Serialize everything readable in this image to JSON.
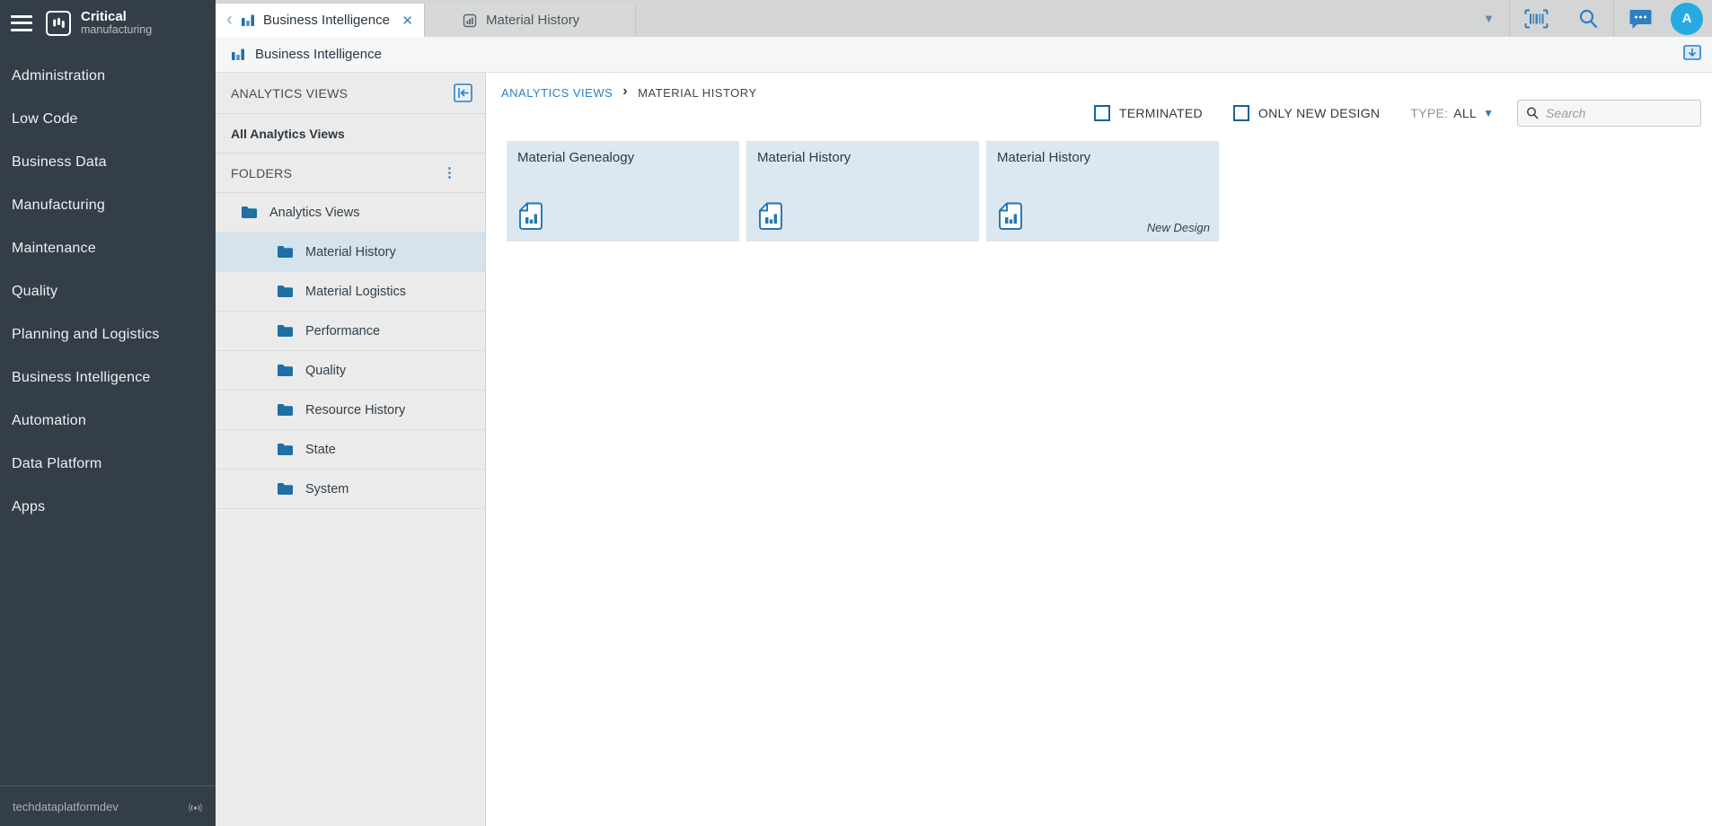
{
  "sidebar": {
    "logo": {
      "title": "Critical",
      "subtitle": "manufacturing"
    },
    "items": [
      "Administration",
      "Low Code",
      "Business Data",
      "Manufacturing",
      "Maintenance",
      "Quality",
      "Planning and Logistics",
      "Business Intelligence",
      "Automation",
      "Data Platform",
      "Apps"
    ],
    "footer": {
      "environment": "techdataplatformdev"
    }
  },
  "tabbar": {
    "tabs": [
      {
        "label": "Business Intelligence",
        "active": true
      },
      {
        "label": "Material History",
        "active": false
      }
    ]
  },
  "toolbar": {
    "avatar_initial": "A"
  },
  "breadcrumb_row": {
    "title": "Business Intelligence"
  },
  "panel": {
    "title": "ANALYTICS VIEWS",
    "all_views_label": "All Analytics Views",
    "folders_title": "FOLDERS",
    "tree": {
      "root": "Analytics Views",
      "children": [
        "Material History",
        "Material Logistics",
        "Performance",
        "Quality",
        "Resource History",
        "State",
        "System"
      ],
      "selected": "Material History"
    }
  },
  "main": {
    "breadcrumb": {
      "parent": "ANALYTICS VIEWS",
      "current": "MATERIAL HISTORY"
    },
    "filters": {
      "terminated_label": "TERMINATED",
      "only_new_design_label": "ONLY NEW DESIGN",
      "type_label": "TYPE:",
      "type_value": "ALL",
      "search_placeholder": "Search"
    },
    "cards": [
      {
        "title": "Material Genealogy",
        "badge": ""
      },
      {
        "title": "Material History",
        "badge": ""
      },
      {
        "title": "Material History",
        "badge": "New Design"
      }
    ]
  },
  "glyphs": {
    "back_chevron": "‹",
    "close": "✕",
    "caret_down": "▼",
    "kebab": "⋮",
    "breadcrumb_sep": "›",
    "type_caret": "▼"
  },
  "colors": {
    "sidebar_bg": "#333e48",
    "accent_blue": "#2b7fc3",
    "folder_blue": "#1d6fa5",
    "selection_bg": "#d5e3ee",
    "card_bg": "#dce7ef",
    "avatar_bg": "#27aae1",
    "tabstrip_bg": "#d4d5d5"
  }
}
